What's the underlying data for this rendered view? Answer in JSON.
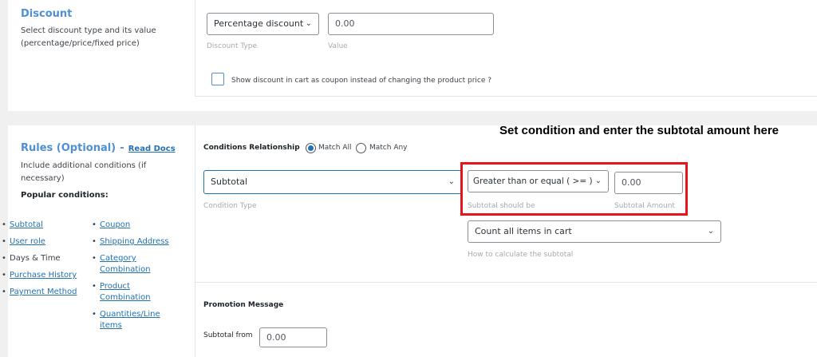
{
  "discount": {
    "title": "Discount",
    "description": "Select discount type and its value (percentage/price/fixed price)",
    "type_select": "Percentage discount",
    "value": "0.00",
    "type_hint": "Discount Type",
    "value_hint": "Value",
    "coupon_checkbox_label": "Show discount in cart as coupon instead of changing the product price ?"
  },
  "rules": {
    "title": "Rules (Optional)",
    "dash": "-",
    "read_docs": "Read Docs",
    "description": "Include additional conditions (if necessary)",
    "popular_label": "Popular conditions:",
    "col1": [
      "Subtotal",
      "User role",
      "Days & Time",
      "Purchase History",
      "Payment Method"
    ],
    "col2": [
      "Coupon",
      "Shipping Address",
      "Category Combination",
      "Product Combination",
      "Quantities/Line items"
    ],
    "relationship_label": "Conditions Relationship",
    "match_all": "Match All",
    "match_any": "Match Any",
    "condition_type": "Subtotal",
    "condition_type_hint": "Condition Type",
    "operator": "Greater than or equal ( >= )",
    "operator_hint": "Subtotal should be",
    "amount": "0.00",
    "amount_hint": "Subtotal Amount",
    "calc_select": "Count all items in cart",
    "calc_hint": "How to calculate the subtotal",
    "promo_title": "Promotion Message",
    "subtotal_from_label": "Subtotal from",
    "subtotal_from_value": "0.00"
  },
  "annotation": {
    "text": "Set condition and enter the subtotal amount here",
    "color": "#e8141b"
  }
}
